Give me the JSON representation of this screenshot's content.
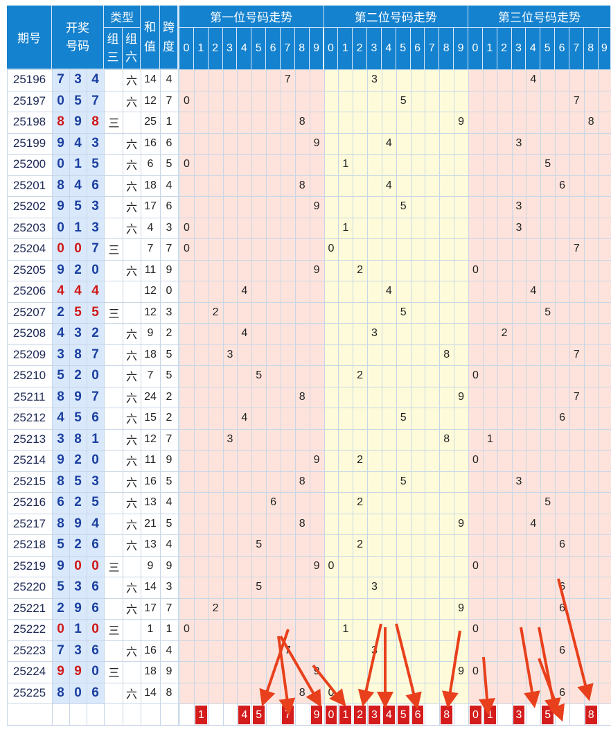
{
  "header": {
    "issue": "期号",
    "draw_line1": "开奖",
    "draw_line2": "号码",
    "type": "类型",
    "group3_a": "组",
    "group3_b": "三",
    "group6_a": "组",
    "group6_b": "六",
    "sum_a": "和",
    "sum_b": "值",
    "span_a": "跨",
    "span_b": "度",
    "pos1": "第一位号码走势",
    "pos2": "第二位号码走势",
    "pos3": "第三位号码走势",
    "digits": [
      "0",
      "1",
      "2",
      "3",
      "4",
      "5",
      "6",
      "7",
      "8",
      "9"
    ]
  },
  "group3_label": "三",
  "group6_label": "六",
  "rows": [
    {
      "issue": "25196",
      "draw": [
        7,
        3,
        4
      ],
      "type": "六",
      "sum": 14,
      "span": 4
    },
    {
      "issue": "25197",
      "draw": [
        0,
        5,
        7
      ],
      "type": "六",
      "sum": 12,
      "span": 7
    },
    {
      "issue": "25198",
      "draw": [
        8,
        9,
        8
      ],
      "type": "三",
      "sum": 25,
      "span": 1
    },
    {
      "issue": "25199",
      "draw": [
        9,
        4,
        3
      ],
      "type": "六",
      "sum": 16,
      "span": 6
    },
    {
      "issue": "25200",
      "draw": [
        0,
        1,
        5
      ],
      "type": "六",
      "sum": 6,
      "span": 5
    },
    {
      "issue": "25201",
      "draw": [
        8,
        4,
        6
      ],
      "type": "六",
      "sum": 18,
      "span": 4
    },
    {
      "issue": "25202",
      "draw": [
        9,
        5,
        3
      ],
      "type": "六",
      "sum": 17,
      "span": 6
    },
    {
      "issue": "25203",
      "draw": [
        0,
        1,
        3
      ],
      "type": "六",
      "sum": 4,
      "span": 3
    },
    {
      "issue": "25204",
      "draw": [
        0,
        0,
        7
      ],
      "type": "三",
      "sum": 7,
      "span": 7
    },
    {
      "issue": "25205",
      "draw": [
        9,
        2,
        0
      ],
      "type": "六",
      "sum": 11,
      "span": 9
    },
    {
      "issue": "25206",
      "draw": [
        4,
        4,
        4
      ],
      "type": "",
      "sum": 12,
      "span": 0
    },
    {
      "issue": "25207",
      "draw": [
        2,
        5,
        5
      ],
      "type": "三",
      "sum": 12,
      "span": 3
    },
    {
      "issue": "25208",
      "draw": [
        4,
        3,
        2
      ],
      "type": "六",
      "sum": 9,
      "span": 2
    },
    {
      "issue": "25209",
      "draw": [
        3,
        8,
        7
      ],
      "type": "六",
      "sum": 18,
      "span": 5
    },
    {
      "issue": "25210",
      "draw": [
        5,
        2,
        0
      ],
      "type": "六",
      "sum": 7,
      "span": 5
    },
    {
      "issue": "25211",
      "draw": [
        8,
        9,
        7
      ],
      "type": "六",
      "sum": 24,
      "span": 2
    },
    {
      "issue": "25212",
      "draw": [
        4,
        5,
        6
      ],
      "type": "六",
      "sum": 15,
      "span": 2
    },
    {
      "issue": "25213",
      "draw": [
        3,
        8,
        1
      ],
      "type": "六",
      "sum": 12,
      "span": 7
    },
    {
      "issue": "25214",
      "draw": [
        9,
        2,
        0
      ],
      "type": "六",
      "sum": 11,
      "span": 9
    },
    {
      "issue": "25215",
      "draw": [
        8,
        5,
        3
      ],
      "type": "六",
      "sum": 16,
      "span": 5
    },
    {
      "issue": "25216",
      "draw": [
        6,
        2,
        5
      ],
      "type": "六",
      "sum": 13,
      "span": 4
    },
    {
      "issue": "25217",
      "draw": [
        8,
        9,
        4
      ],
      "type": "六",
      "sum": 21,
      "span": 5
    },
    {
      "issue": "25218",
      "draw": [
        5,
        2,
        6
      ],
      "type": "六",
      "sum": 13,
      "span": 4
    },
    {
      "issue": "25219",
      "draw": [
        9,
        0,
        0
      ],
      "type": "三",
      "sum": 9,
      "span": 9
    },
    {
      "issue": "25220",
      "draw": [
        5,
        3,
        6
      ],
      "type": "六",
      "sum": 14,
      "span": 3
    },
    {
      "issue": "25221",
      "draw": [
        2,
        9,
        6
      ],
      "type": "六",
      "sum": 17,
      "span": 7
    },
    {
      "issue": "25222",
      "draw": [
        0,
        1,
        0
      ],
      "type": "三",
      "sum": 1,
      "span": 1
    },
    {
      "issue": "25223",
      "draw": [
        7,
        3,
        6
      ],
      "type": "六",
      "sum": 16,
      "span": 4
    },
    {
      "issue": "25224",
      "draw": [
        9,
        9,
        0
      ],
      "type": "三",
      "sum": 18,
      "span": 9
    },
    {
      "issue": "25225",
      "draw": [
        8,
        0,
        6
      ],
      "type": "六",
      "sum": 14,
      "span": 8
    }
  ],
  "selection": {
    "pos1": [
      1,
      4,
      5,
      7,
      9
    ],
    "pos2": [
      0,
      1,
      2,
      3,
      4,
      5,
      6,
      8
    ],
    "pos3": [
      0,
      1,
      3,
      5,
      8
    ]
  },
  "colors": {
    "header_blue": "#1582cf",
    "pos1_bg": "#fde3dc",
    "pos2_bg": "#fdfbd9",
    "pos3_bg": "#fde3dc",
    "badge_red": "#d41c1c",
    "arrow_red": "#e8401c",
    "draw_blue": "#1b3fa0",
    "draw_pair_red": "#d01818",
    "draw_col_bg": "#d9e9fb"
  },
  "arrows_icon": "red-arrow-annotation-icon"
}
